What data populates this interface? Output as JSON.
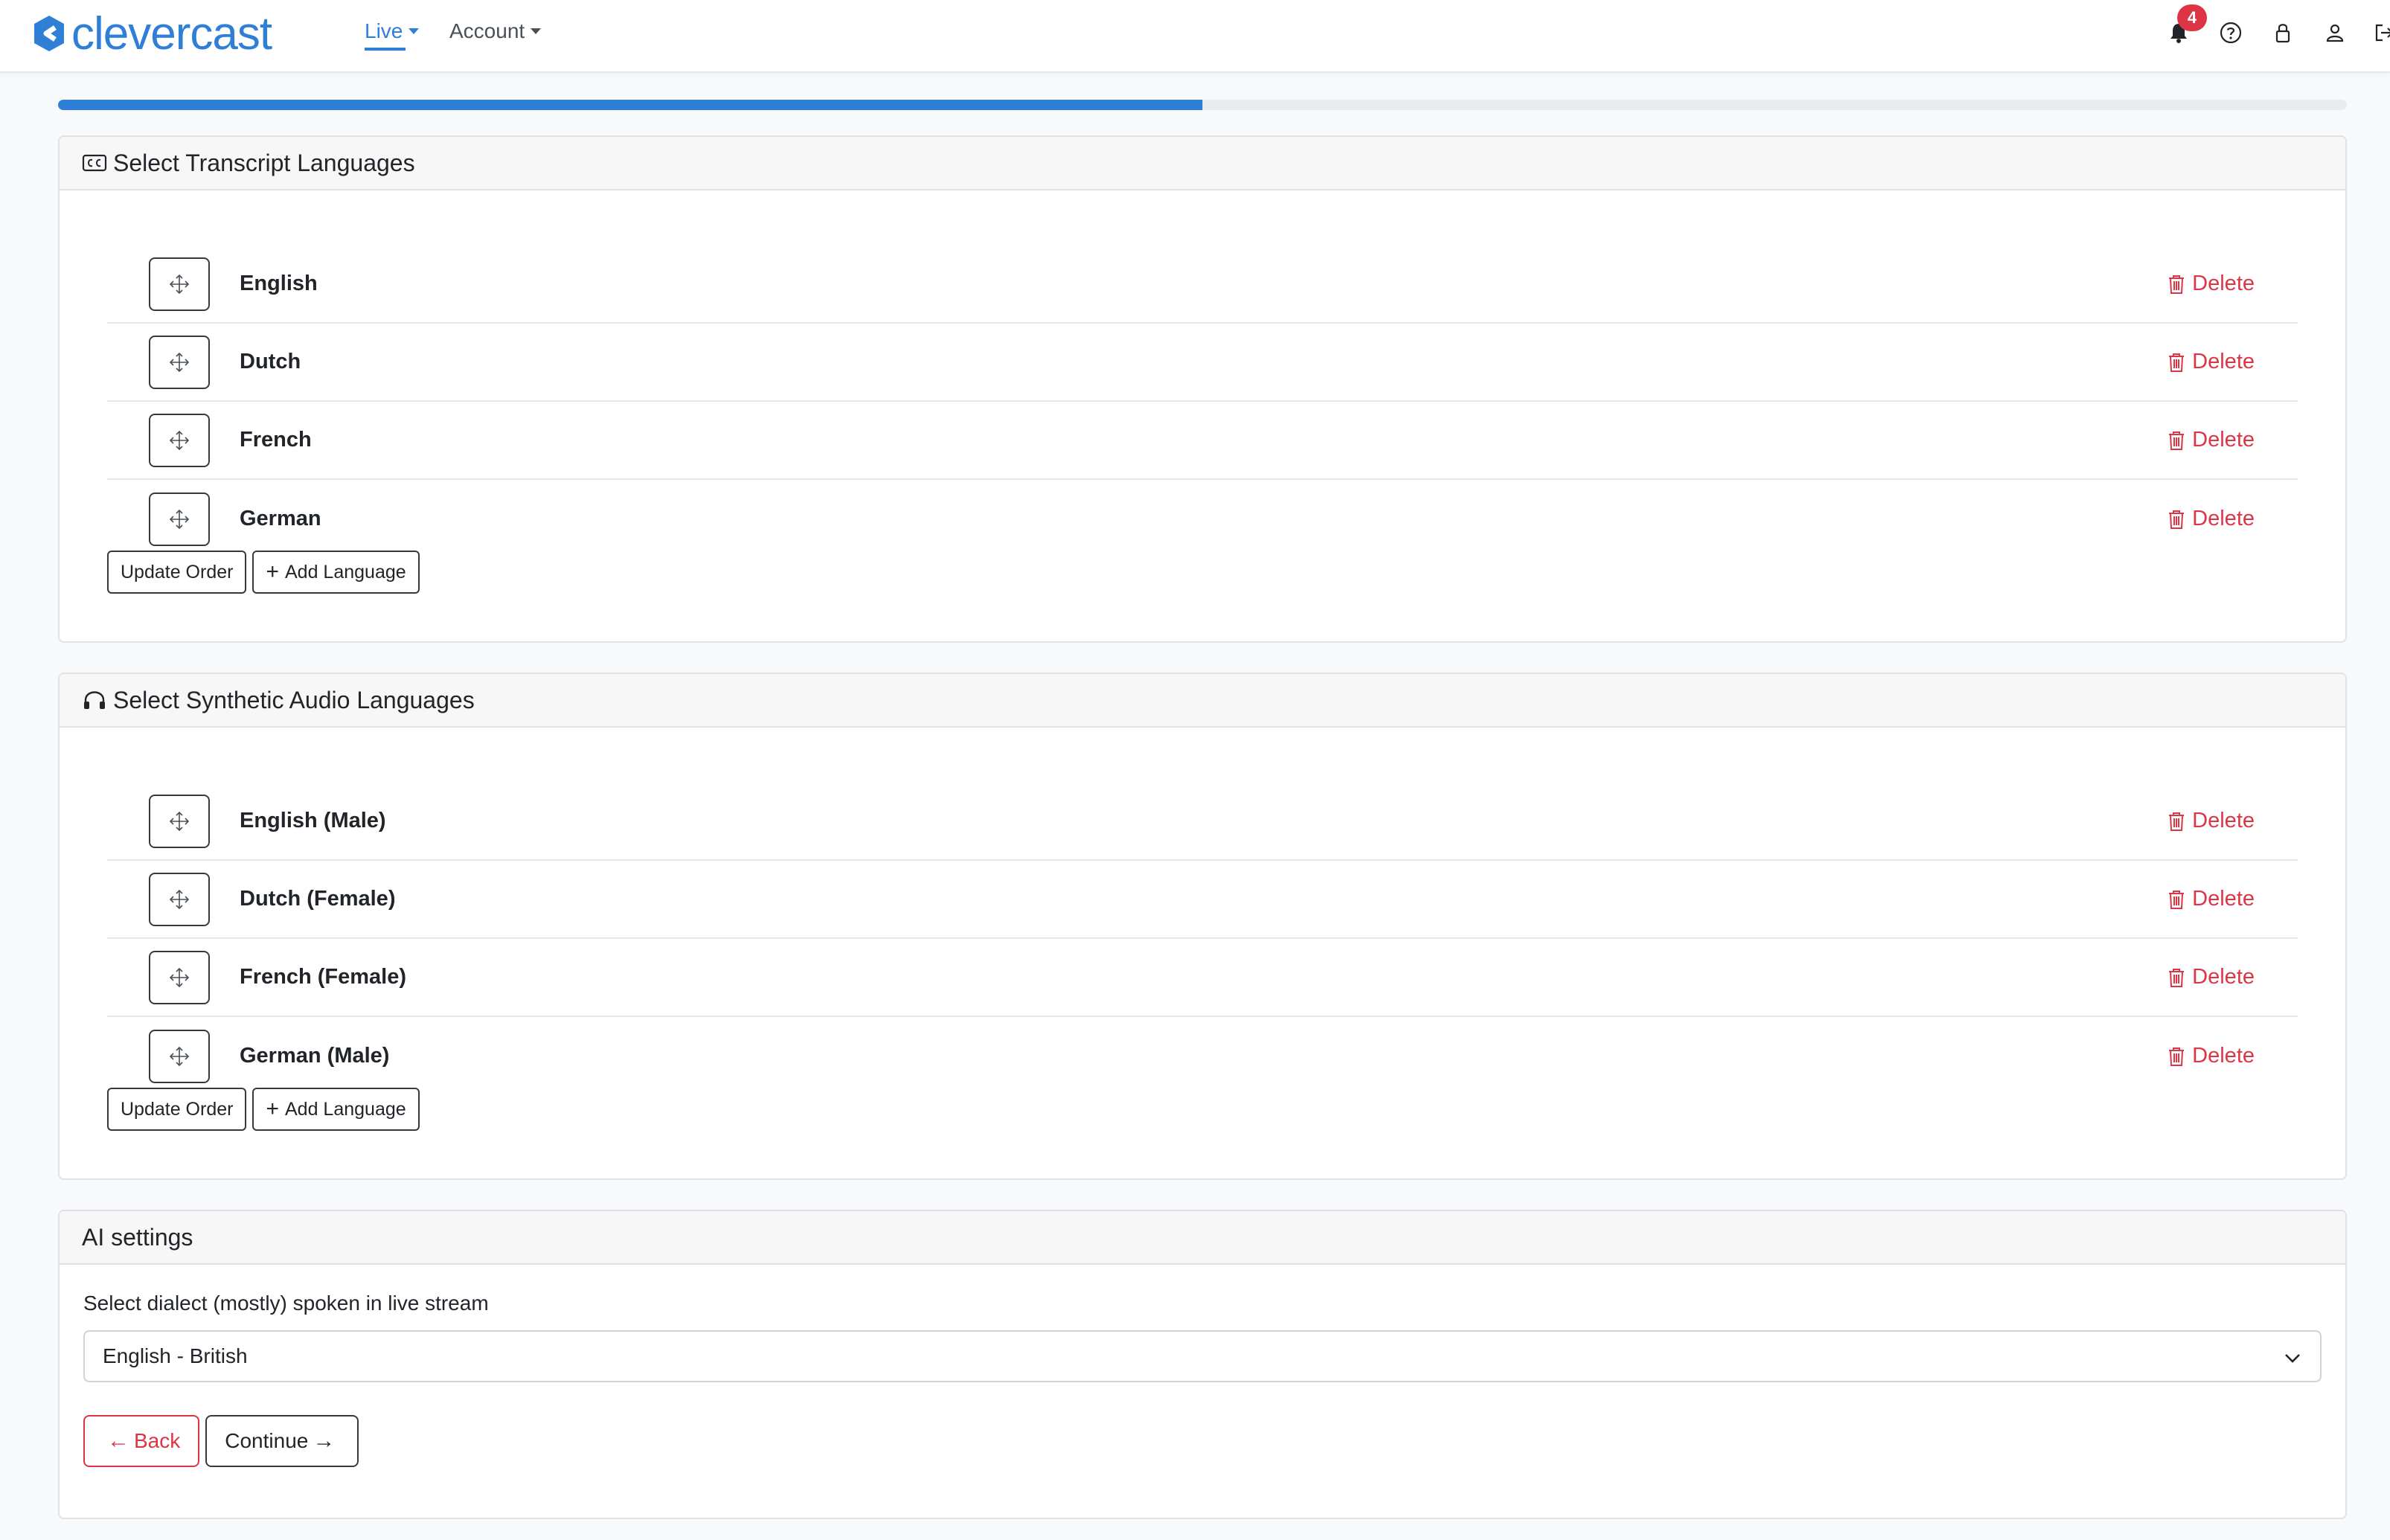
{
  "brand": {
    "name": "clevercast",
    "color": "#2f7fd6"
  },
  "nav": {
    "items": [
      {
        "label": "Live",
        "active": true
      },
      {
        "label": "Account",
        "active": false
      }
    ],
    "notifications_count": "4",
    "icons": [
      "bell-icon",
      "help-icon",
      "lock-icon",
      "user-icon",
      "logout-icon"
    ]
  },
  "progress": {
    "percent": 50
  },
  "transcript": {
    "title": "Select Transcript Languages",
    "icon": "closed-captions-icon",
    "languages": [
      {
        "name": "English"
      },
      {
        "name": "Dutch"
      },
      {
        "name": "French"
      },
      {
        "name": "German"
      }
    ],
    "delete_label": "Delete",
    "update_label": "Update Order",
    "add_label": "Add Language"
  },
  "audio": {
    "title": "Select Synthetic Audio Languages",
    "icon": "headphones-icon",
    "languages": [
      {
        "name": "English (Male)"
      },
      {
        "name": "Dutch (Female)"
      },
      {
        "name": "French (Female)"
      },
      {
        "name": "German (Male)"
      }
    ],
    "delete_label": "Delete",
    "update_label": "Update Order",
    "add_label": "Add Language"
  },
  "ai": {
    "title": "AI settings",
    "dialect_label": "Select dialect (mostly) spoken in live stream",
    "dialect_value": "English - British",
    "back_label": "Back",
    "continue_label": "Continue"
  },
  "colors": {
    "accent": "#2f7fd6",
    "danger": "#dc3545"
  }
}
